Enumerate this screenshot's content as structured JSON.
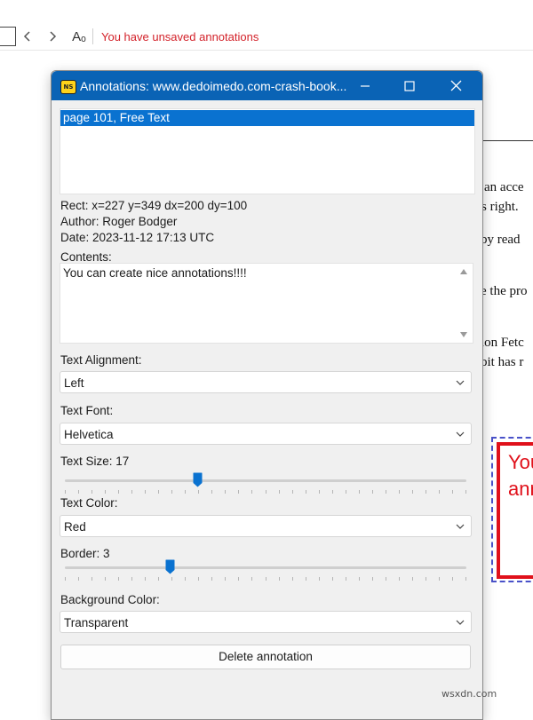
{
  "toolbar": {
    "status_text": "You have unsaved annotations",
    "font_button_label": "Aₒ",
    "back_icon": "chevron-left-icon",
    "forward_icon": "chevron-right-icon"
  },
  "document": {
    "lines": [
      "an acce",
      "s right.",
      "by read",
      "e the pro",
      "ion Fetc",
      "bit has r"
    ],
    "annotation_preview": [
      "You",
      "ann"
    ]
  },
  "dialog": {
    "title": "Annotations: www.dedoimedo.com-crash-book...",
    "app_icon_text": "NS",
    "list_items": [
      "page 101, Free Text"
    ],
    "rect": "Rect: x=227 y=349 dx=200 dy=100",
    "author": "Author: Roger Bodger",
    "date": "Date: 2023-11-12 17:13 UTC",
    "contents_label": "Contents:",
    "contents_value": "You can create nice annotations!!!!",
    "text_alignment_label": "Text Alignment:",
    "text_alignment_value": "Left",
    "text_font_label": "Text Font:",
    "text_font_value": "Helvetica",
    "text_size_label": "Text Size: 17",
    "text_size_fraction": 0.33,
    "text_color_label": "Text Color:",
    "text_color_value": "Red",
    "border_label": "Border: 3",
    "border_fraction": 0.26,
    "background_color_label": "Background Color:",
    "background_color_value": "Transparent",
    "delete_button": "Delete annotation"
  },
  "colors": {
    "title_bar": "#0a63b5",
    "selection": "#0a72d0",
    "slider_thumb": "#0a72d0",
    "status_text": "#d3222a",
    "annotation_red": "#e0101a"
  },
  "watermark": "wsxdn.com"
}
